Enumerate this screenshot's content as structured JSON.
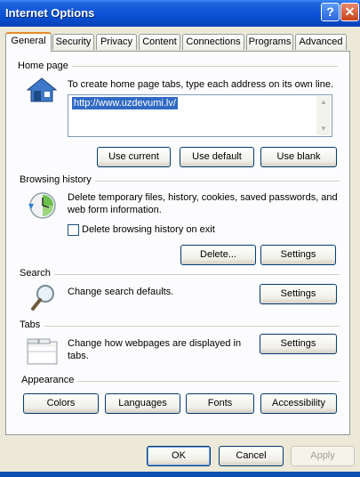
{
  "window": {
    "title": "Internet Options",
    "help_label": "?",
    "close_label": "✕"
  },
  "tabs": [
    {
      "label": "General",
      "active": true
    },
    {
      "label": "Security"
    },
    {
      "label": "Privacy"
    },
    {
      "label": "Content"
    },
    {
      "label": "Connections"
    },
    {
      "label": "Programs"
    },
    {
      "label": "Advanced"
    }
  ],
  "home_page": {
    "title": "Home page",
    "description": "To create home page tabs, type each address on its own line.",
    "url": "http://www.uzdevumi.lv/",
    "buttons": {
      "use_current": "Use current",
      "use_default": "Use default",
      "use_blank": "Use blank"
    },
    "icon": "house-icon"
  },
  "browsing_history": {
    "title": "Browsing history",
    "description": "Delete temporary files, history, cookies, saved passwords, and web form information.",
    "checkbox_label": "Delete browsing history on exit",
    "checked": false,
    "buttons": {
      "delete": "Delete...",
      "settings": "Settings"
    },
    "icon": "history-clock-icon"
  },
  "search": {
    "title": "Search",
    "description": "Change search defaults.",
    "settings": "Settings",
    "icon": "magnifier-icon"
  },
  "tabs_section": {
    "title": "Tabs",
    "description": "Change how webpages are displayed in tabs.",
    "settings": "Settings",
    "icon": "tabbed-window-icon"
  },
  "appearance": {
    "title": "Appearance",
    "buttons": {
      "colors": "Colors",
      "languages": "Languages",
      "fonts": "Fonts",
      "accessibility": "Accessibility"
    }
  },
  "footer": {
    "ok": "OK",
    "cancel": "Cancel",
    "apply": "Apply",
    "apply_enabled": false
  }
}
